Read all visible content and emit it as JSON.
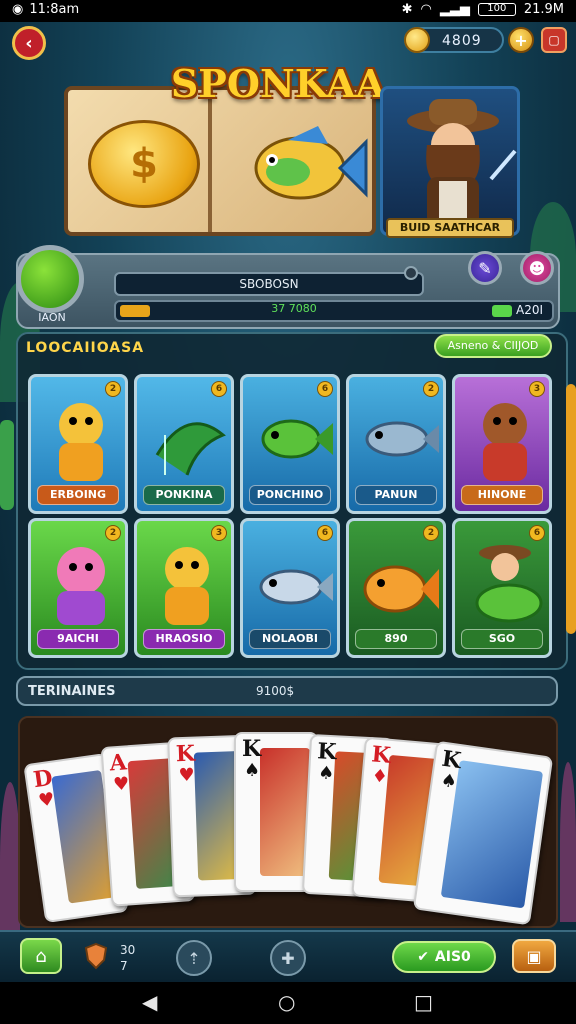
{
  "status_bar": {
    "time": "11:8am",
    "right_time": "21.9M",
    "battery": "100"
  },
  "hud": {
    "coins": "4809",
    "plus": "+"
  },
  "banner": {
    "logo": "SPONKAA",
    "character_caption": "BUID SAATHCAR"
  },
  "profile": {
    "avatar_label": "IAON",
    "name": "SBOBOSN",
    "xp_text": "37 7080",
    "level_value": "A20I"
  },
  "grid": {
    "title": "LOOCAIIOASA",
    "action_label": "Asneno & CIIJOD",
    "cards": [
      {
        "label": "ERBOING",
        "badge": "2"
      },
      {
        "label": "PONKINA",
        "badge": "6"
      },
      {
        "label": "PONCHINO",
        "badge": "6"
      },
      {
        "label": "PANUN",
        "badge": "2"
      },
      {
        "label": "HINONE",
        "badge": "3"
      },
      {
        "label": "9AICHI",
        "badge": "2"
      },
      {
        "label": "HRAOSIO",
        "badge": "3"
      },
      {
        "label": "NOLAOBI",
        "badge": "6"
      },
      {
        "label": "890",
        "badge": "2"
      },
      {
        "label": "SGO",
        "badge": "6"
      }
    ]
  },
  "recent": {
    "title": "TERINAINES",
    "value": "9100$"
  },
  "hand": [
    {
      "rank": "D",
      "suit": "♥",
      "color": "#d41c24"
    },
    {
      "rank": "A",
      "suit": "♥",
      "color": "#d41c24"
    },
    {
      "rank": "K",
      "suit": "♥",
      "color": "#d41c24"
    },
    {
      "rank": "K",
      "suit": "♠",
      "color": "#111111"
    },
    {
      "rank": "K",
      "suit": "♠",
      "color": "#111111"
    },
    {
      "rank": "K",
      "suit": "♦",
      "color": "#d41c24"
    },
    {
      "rank": "K",
      "suit": "♠",
      "color": "#111111"
    }
  ],
  "bottom_bar": {
    "stat_top": "30",
    "stat_bottom": "7",
    "play_label": "AIS0"
  },
  "colors": {
    "accent_gold": "#ffd54a",
    "play_green": "#2a9a20",
    "panel": "#102834"
  }
}
